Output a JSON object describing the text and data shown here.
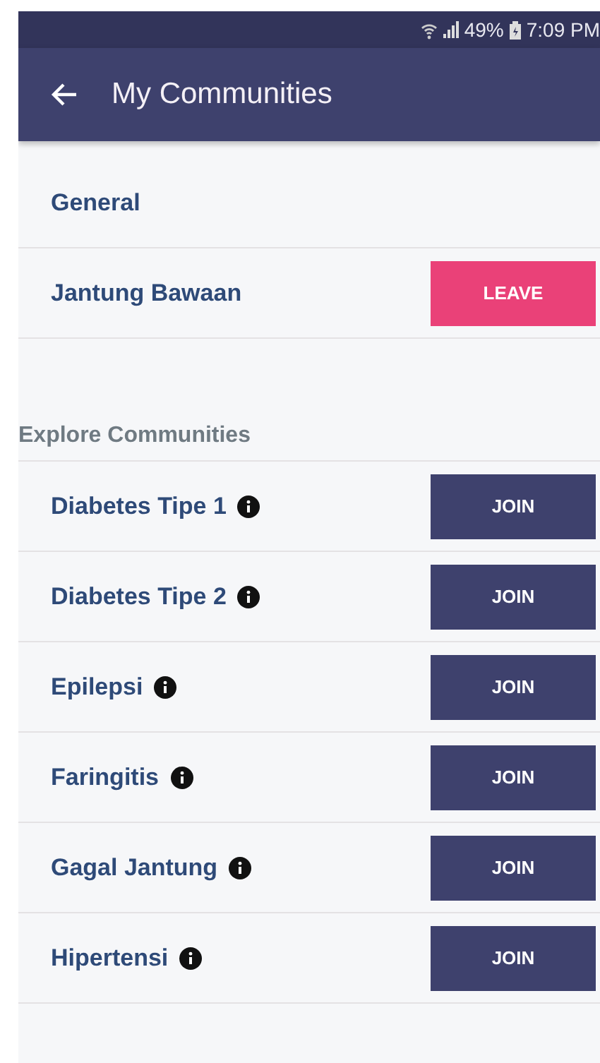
{
  "status_bar": {
    "battery": "49%",
    "time": "7:09 PM"
  },
  "toolbar": {
    "title": "My Communities"
  },
  "my_communities": [
    {
      "name": "General",
      "info": false
    },
    {
      "name": "Jantung Bawaan",
      "info": false,
      "button": {
        "label": "LEAVE",
        "kind": "leave"
      }
    }
  ],
  "explore": {
    "heading": "Explore Communities",
    "items": [
      {
        "name": "Diabetes Tipe 1",
        "info": true,
        "button": {
          "label": "JOIN",
          "kind": "join"
        }
      },
      {
        "name": "Diabetes Tipe 2",
        "info": true,
        "button": {
          "label": "JOIN",
          "kind": "join"
        }
      },
      {
        "name": "Epilepsi",
        "info": true,
        "button": {
          "label": "JOIN",
          "kind": "join"
        }
      },
      {
        "name": "Faringitis",
        "info": true,
        "button": {
          "label": "JOIN",
          "kind": "join"
        }
      },
      {
        "name": "Gagal Jantung",
        "info": true,
        "button": {
          "label": "JOIN",
          "kind": "join"
        }
      },
      {
        "name": "Hipertensi",
        "info": true,
        "button": {
          "label": "JOIN",
          "kind": "join"
        }
      }
    ]
  }
}
